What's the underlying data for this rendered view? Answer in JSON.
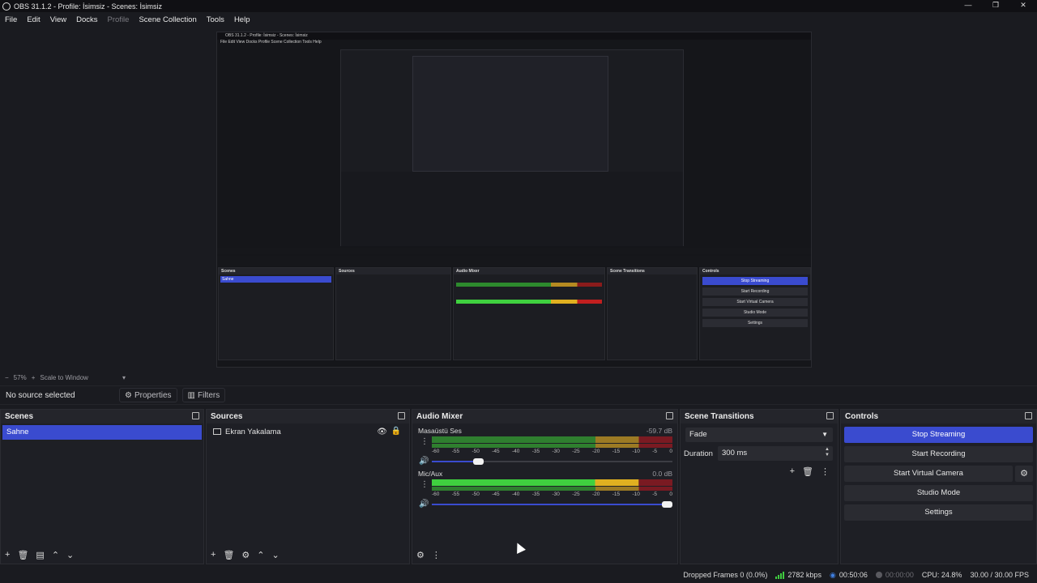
{
  "window": {
    "title": "OBS 31.1.2 - Profile: İsimsiz - Scenes: İsimsiz",
    "controls": [
      "—",
      "❐",
      "✕"
    ]
  },
  "menu": {
    "file": "File",
    "edit": "Edit",
    "view": "View",
    "docks": "Docks",
    "profile": "Profile",
    "scene_collection": "Scene Collection",
    "tools": "Tools",
    "help": "Help"
  },
  "preview": {
    "nested_title": "OBS 31.1.2 - Profile: İsimsiz - Scenes: İsimsiz",
    "nested_menu": "File  Edit  View  Docks  Profile  Scene Collection  Tools  Help"
  },
  "zoom": {
    "minus": "−",
    "level": "57%",
    "plus": "+",
    "mode": "Scale to Window",
    "caret": "▾"
  },
  "source_toolbar": {
    "status": "No source selected",
    "properties": "Properties",
    "filters": "Filters"
  },
  "scenes": {
    "title": "Scenes",
    "items": [
      "Sahne"
    ]
  },
  "sources": {
    "title": "Sources",
    "items": [
      {
        "label": "Ekran Yakalama"
      }
    ]
  },
  "mixer": {
    "title": "Audio Mixer",
    "ticks": [
      "-60",
      "-55",
      "-50",
      "-45",
      "-40",
      "-35",
      "-30",
      "-25",
      "-20",
      "-15",
      "-10",
      "-5",
      "0"
    ],
    "tracks": [
      {
        "name": "Masaüstü Ses",
        "db": "-59.7 dB",
        "volume": 0.18
      },
      {
        "name": "Mic/Aux",
        "db": "0.0 dB",
        "volume": 1.0
      }
    ]
  },
  "transitions": {
    "title": "Scene Transitions",
    "selected": "Fade",
    "duration_label": "Duration",
    "duration_value": "300 ms"
  },
  "controls": {
    "title": "Controls",
    "stop_streaming": "Stop Streaming",
    "start_recording": "Start Recording",
    "start_virtual_camera": "Start Virtual Camera",
    "studio_mode": "Studio Mode",
    "settings": "Settings"
  },
  "status": {
    "dropped_frames": "Dropped Frames 0 (0.0%)",
    "bitrate": "2782 kbps",
    "stream_time": "00:50:06",
    "record_time": "00:00:00",
    "cpu": "CPU: 24.8%",
    "fps": "30.00 / 30.00 FPS"
  },
  "colors": {
    "accent": "#3a4bcf",
    "meter_green": "#3fd03f",
    "meter_yellow": "#e0b020",
    "meter_red": "#c21f1f"
  }
}
